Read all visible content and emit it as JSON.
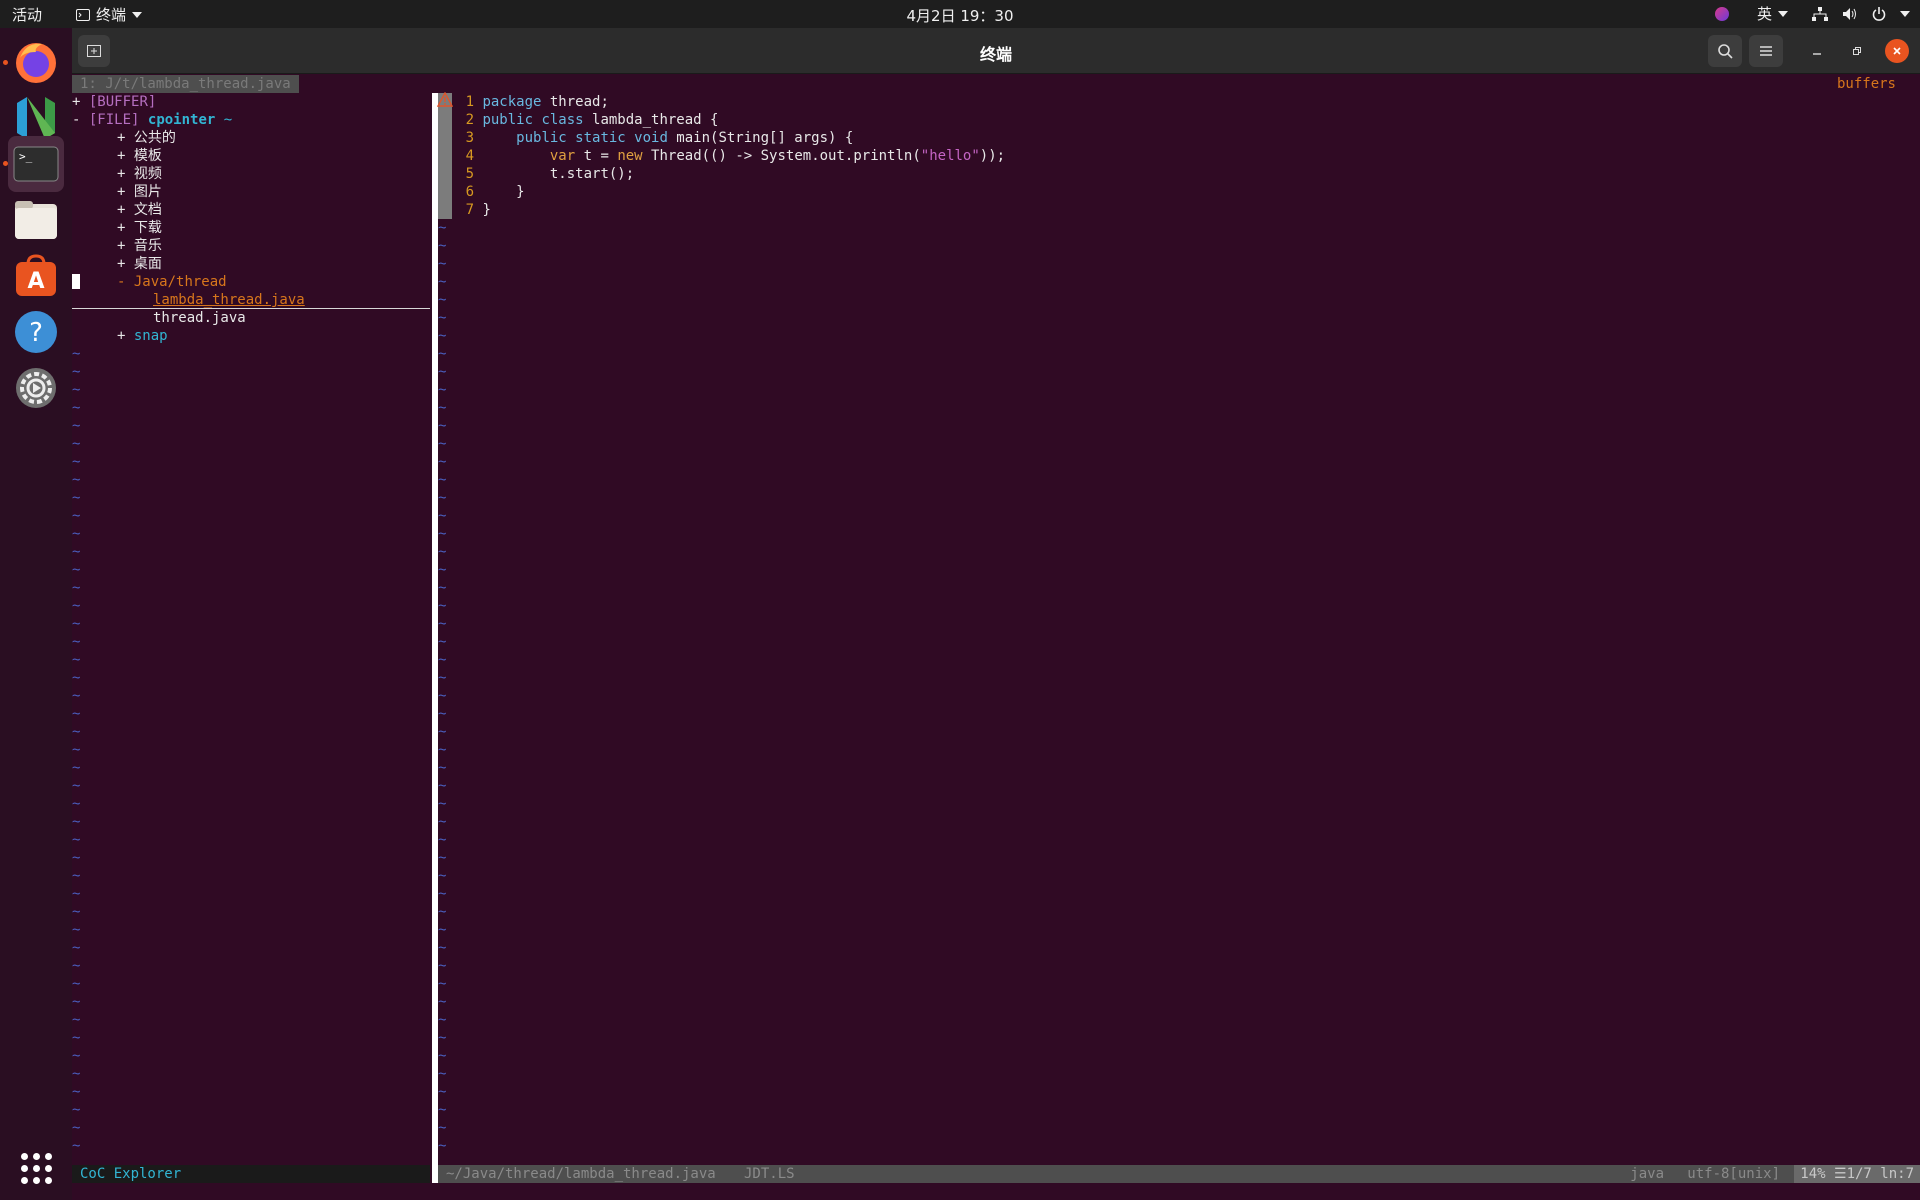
{
  "topbar": {
    "activities": "活动",
    "app_name": "终端",
    "clock": "4月2日  19：30",
    "input_method": "英"
  },
  "dock": {
    "items": [
      "firefox-icon",
      "neovim-icon",
      "terminal-icon",
      "files-icon",
      "software-icon",
      "help-icon",
      "settings-icon",
      "show-apps-icon"
    ]
  },
  "window": {
    "title": "终端"
  },
  "tabline": {
    "tab": "1: J/t/lambda_thread.java",
    "right": "buffers"
  },
  "explorer": {
    "buffer_toggle": "+",
    "buffer_label": "[BUFFER]",
    "file_toggle": "-",
    "file_label": "[FILE]",
    "root": "cpointer",
    "root_tilde": "~",
    "dirs": [
      {
        "toggle": "+",
        "name": "公共的"
      },
      {
        "toggle": "+",
        "name": "模板"
      },
      {
        "toggle": "+",
        "name": "视频"
      },
      {
        "toggle": "+",
        "name": "图片"
      },
      {
        "toggle": "+",
        "name": "文档"
      },
      {
        "toggle": "+",
        "name": "下载"
      },
      {
        "toggle": "+",
        "name": "音乐"
      },
      {
        "toggle": "+",
        "name": "桌面"
      }
    ],
    "java_toggle": "-",
    "java_dir": "Java/thread",
    "files": [
      "lambda_thread.java",
      "thread.java"
    ],
    "snap_toggle": "+",
    "snap": "snap",
    "status": "CoC Explorer"
  },
  "editor": {
    "line_numbers": [
      "1",
      "2",
      "3",
      "4",
      "5",
      "6",
      "7"
    ],
    "code": {
      "l1_kw": "package",
      "l1_rest": " thread;",
      "l2_kw": "public class",
      "l2_rest": " lambda_thread {",
      "l3_indent": "    ",
      "l3_kw": "public static void",
      "l3_rest": " main(String[] args) {",
      "l4_indent": "        ",
      "l4_kw1": "var",
      "l4_mid1": " t = ",
      "l4_kw2": "new",
      "l4_mid2": " Thread(() -> System.out.println(",
      "l4_str": "\"hello\"",
      "l4_end": "));",
      "l5": "        t.start();",
      "l6": "    }",
      "l7": "}"
    },
    "status_path": "~/Java/thread/lambda_thread.java",
    "status_ls": "JDT.LS",
    "status_filetype": "java",
    "status_encoding": "utf-8[unix]",
    "status_position": "14% ☰1/7 ln:7"
  },
  "eob_char": "~"
}
